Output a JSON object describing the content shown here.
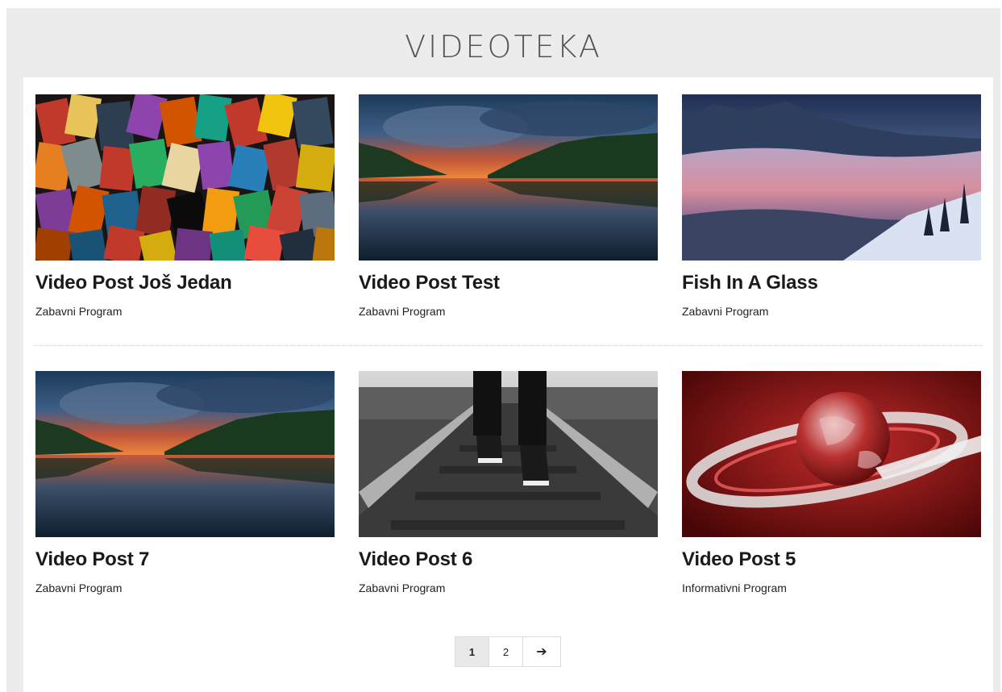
{
  "page": {
    "title": "VIDEOTEKA"
  },
  "videos": [
    {
      "title": "Video Post Još Jedan",
      "category": "Zabavni Program",
      "thumbnail": "collage-of-film-posters"
    },
    {
      "title": "Video Post Test",
      "category": "Zabavni Program",
      "thumbnail": "lake-sunset-under-storm-clouds"
    },
    {
      "title": "Fish In A Glass",
      "category": "Zabavni Program",
      "thumbnail": "mountains-above-fog-sea"
    },
    {
      "title": "Video Post 7",
      "category": "Zabavni Program",
      "thumbnail": "lake-sunset-under-storm-clouds"
    },
    {
      "title": "Video Post 6",
      "category": "Zabavni Program",
      "thumbnail": "sneakers-on-railway-tracks"
    },
    {
      "title": "Video Post 5",
      "category": "Informativni Program",
      "thumbnail": "red-news-globe"
    }
  ],
  "pagination": {
    "pages": [
      "1",
      "2"
    ],
    "current": "1",
    "next_icon": "arrow-right-icon"
  }
}
